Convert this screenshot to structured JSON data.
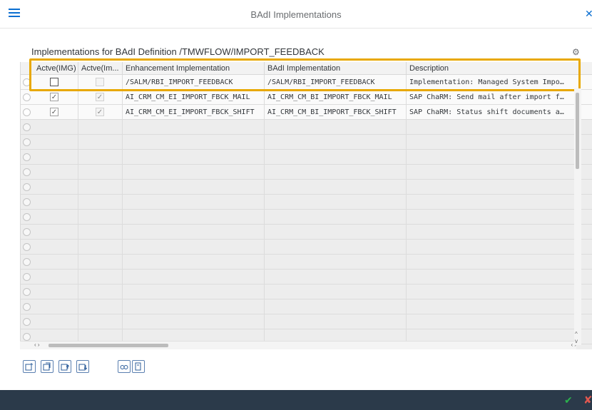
{
  "window": {
    "title": "BAdI Implementations",
    "menu_icon": "hamburger-menu-icon",
    "close_icon": "close-x-icon"
  },
  "section": {
    "title": "Implementations for BAdI Definition /TMWFLOW/IMPORT_FEEDBACK",
    "settings_icon": "gear-icon"
  },
  "table": {
    "columns": [
      {
        "label": "Actve(IMG)"
      },
      {
        "label": "Actve(Im..."
      },
      {
        "label": "Enhancement Implementation"
      },
      {
        "label": "BAdI Implementation"
      },
      {
        "label": "Description"
      }
    ],
    "rows": [
      {
        "active_img": false,
        "active_impl": false,
        "enhancement": "/SALM/RBI_IMPORT_FEEDBACK",
        "badi": "/SALM/RBI_IMPORT_FEEDBACK",
        "description": "Implementation: Managed System Impo…"
      },
      {
        "active_img": true,
        "active_impl": true,
        "enhancement": "AI_CRM_CM_EI_IMPORT_FBCK_MAIL",
        "badi": "AI_CRM_CM_BI_IMPORT_FBCK_MAIL",
        "description": "SAP ChaRM: Send mail after import f…"
      },
      {
        "active_img": true,
        "active_impl": true,
        "enhancement": "AI_CRM_CM_EI_IMPORT_FBCK_SHIFT",
        "badi": "AI_CRM_CM_BI_IMPORT_FBCK_SHIFT",
        "description": "SAP ChaRM: Status shift documents a…"
      }
    ],
    "empty_rows": 15,
    "highlight_color": "#e8a800"
  },
  "toolbar": {
    "buttons": [
      "insert-row-icon",
      "copy-row-icon",
      "move-up-icon",
      "move-down-icon",
      "find-icon",
      "details-icon"
    ]
  },
  "footer": {
    "ok_icon": "checkmark-icon",
    "cancel_icon": "cancel-x-icon",
    "ok_color": "#2bb24c",
    "cancel_color": "#e0574f"
  }
}
